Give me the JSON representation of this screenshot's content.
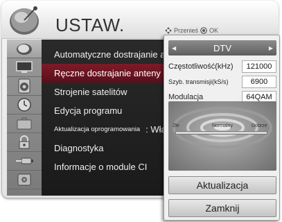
{
  "header": {
    "title": "USTAW.",
    "hint_move": "Przenieś",
    "hint_ok": "OK",
    "icon": "satellite-dish-icon"
  },
  "sidebar": {
    "icons": [
      "satellite-dish-icon",
      "monitor-icon",
      "speaker-icon",
      "clock-icon",
      "briefcase-icon",
      "lock-icon",
      "cable-icon",
      "settings-icon"
    ]
  },
  "menu": {
    "items": [
      {
        "label": "Automatyczne dostrajanie anteny"
      },
      {
        "label": "Ręczne dostrajanie anteny"
      },
      {
        "label": "Strojenie satelitów"
      },
      {
        "label": "Edycja programu"
      },
      {
        "label": "Aktualizacja oprogramowania",
        "value": ": Włą"
      },
      {
        "label": "Diagnostyka"
      },
      {
        "label": "Informacje o module CI"
      }
    ],
    "selected_index": 1
  },
  "dialog": {
    "mode": "DTV",
    "params": [
      {
        "label": "Częstotliwość(kHz)",
        "value": "121000"
      },
      {
        "label": "Szyb. transmisji(kS/s)",
        "value": "6900"
      },
      {
        "label": "Modulacja",
        "value": "64QAM"
      }
    ],
    "signal": {
      "labels": [
        "Złe",
        "Normalny",
        "Dobrze"
      ],
      "level": 0.0
    },
    "buttons": {
      "update": "Aktualizacja",
      "close": "Zamknij"
    }
  },
  "colors": {
    "selected_item": "#6f1522",
    "menu_bg": "#1f1f1f",
    "sidebar_bg": "#8a8a8a"
  }
}
